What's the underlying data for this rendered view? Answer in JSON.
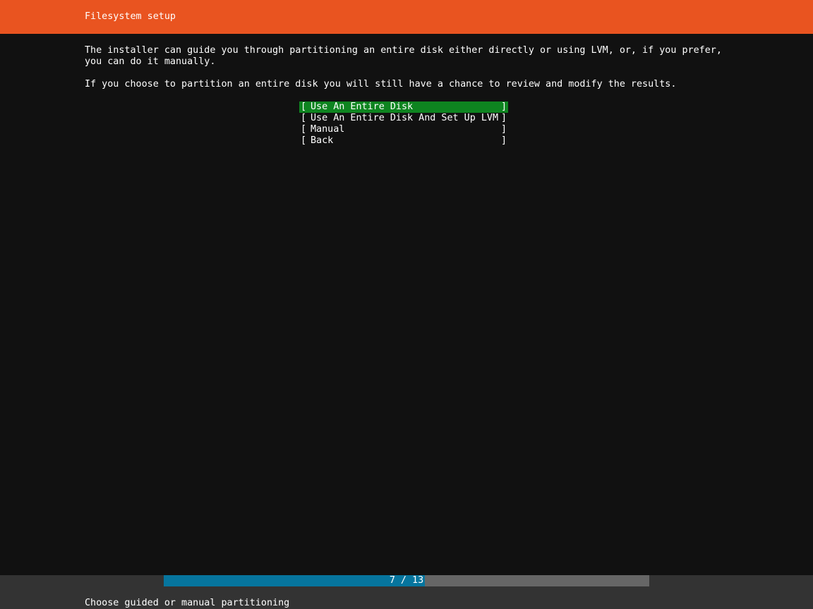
{
  "header": {
    "title": "Filesystem setup"
  },
  "body": {
    "intro_text": "The installer can guide you through partitioning an entire disk either directly or using LVM, or, if you prefer,\nyou can do it manually.\n\nIf you choose to partition an entire disk you will still have a chance to review and modify the results."
  },
  "menu": {
    "items": [
      {
        "label": "Use An Entire Disk",
        "selected": true
      },
      {
        "label": "Use An Entire Disk And Set Up LVM",
        "selected": false
      },
      {
        "label": "Manual",
        "selected": false
      },
      {
        "label": "Back",
        "selected": false
      }
    ],
    "bracket_open": "[",
    "bracket_close": "]"
  },
  "footer": {
    "progress_text": "7 / 13",
    "progress_current": 7,
    "progress_total": 13,
    "help_text": "Choose guided or manual partitioning"
  },
  "colors": {
    "header_bg": "#e95420",
    "body_bg": "#111111",
    "selected_bg": "#0e8420",
    "progress_fill": "#06759e",
    "progress_track": "#666666",
    "footer_bg": "#333333"
  }
}
